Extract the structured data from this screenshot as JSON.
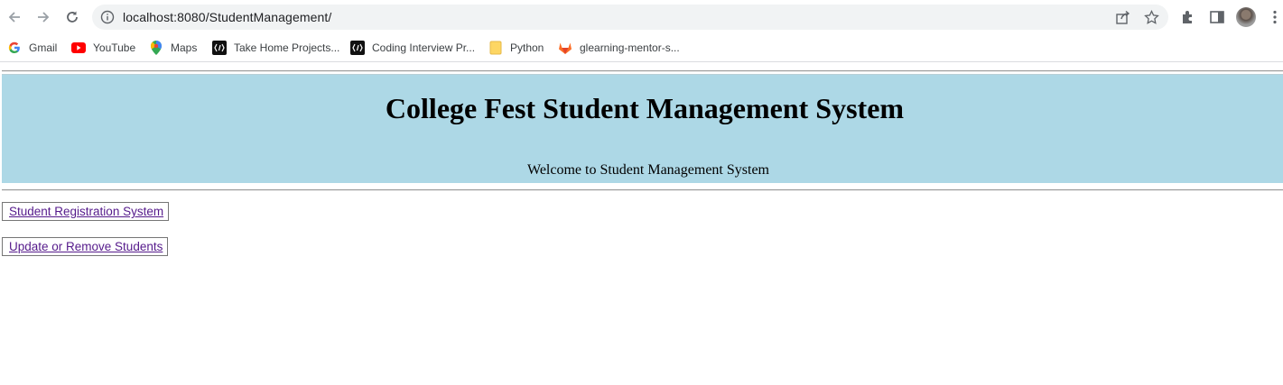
{
  "browser": {
    "url": "localhost:8080/StudentManagement/",
    "icons": [
      "back-arrow-icon",
      "forward-arrow-icon",
      "reload-icon",
      "info-icon",
      "share-icon",
      "star-icon",
      "extensions-icon",
      "side-panel-icon",
      "avatar",
      "menu-dots-icon"
    ]
  },
  "bookmarks": [
    {
      "label": "Gmail",
      "icon": "google-g-icon"
    },
    {
      "label": "YouTube",
      "icon": "youtube-icon"
    },
    {
      "label": "Maps",
      "icon": "maps-pin-icon"
    },
    {
      "label": "Take Home Projects...",
      "icon": "code-bracket-icon"
    },
    {
      "label": "Coding Interview Pr...",
      "icon": "code-bracket-icon"
    },
    {
      "label": "Python",
      "icon": "folder-icon"
    },
    {
      "label": "glearning-mentor-s...",
      "icon": "gitlab-icon"
    }
  ],
  "page": {
    "title": "College Fest Student Management System",
    "welcome": "Welcome to Student Management System",
    "links": [
      {
        "label": "Student Registration System"
      },
      {
        "label": "Update or Remove Students"
      }
    ]
  },
  "colors": {
    "banner_bg": "#add8e6",
    "link_visited": "#551a8b"
  }
}
